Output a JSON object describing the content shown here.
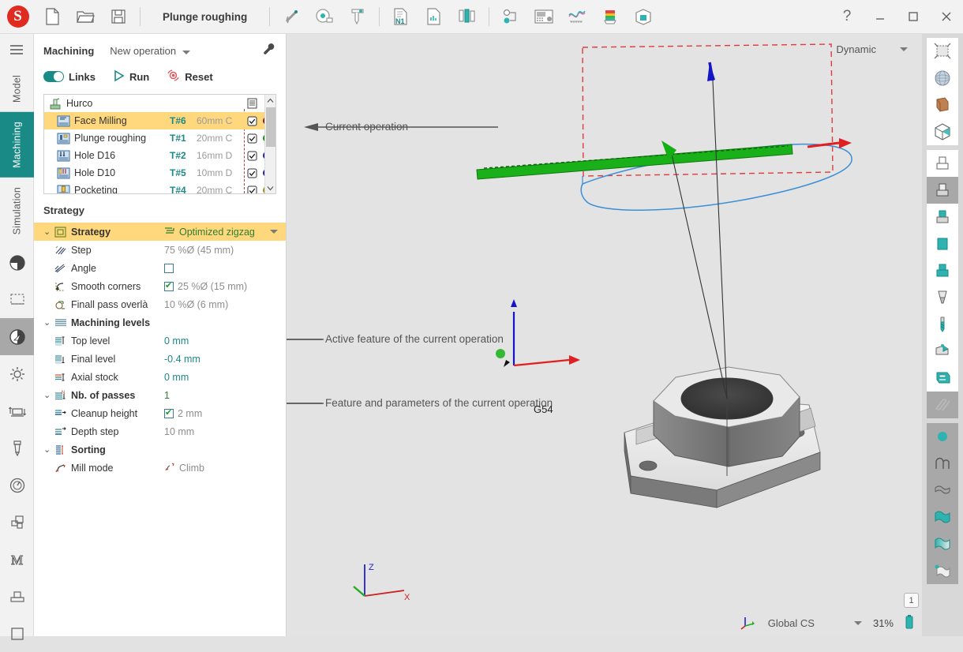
{
  "app": {
    "logo_letter": "S",
    "document_title": "Plunge roughing",
    "help_label": "?",
    "minimize_label": "–",
    "maximize_label": "□",
    "close_label": "✕"
  },
  "top_toolbar": {
    "file_icons": [
      "new-document-icon",
      "open-folder-icon",
      "save-disk-icon"
    ],
    "tool_icons": [
      "magnet-icon",
      "measure-tape-icon",
      "caliper-icon",
      "nc-program-icon",
      "report-document-icon",
      "tool-library-icon",
      "node-link-icon",
      "cnc-controller-icon",
      "feed-curve-icon",
      "stock-colors-icon",
      "stock-box-icon"
    ]
  },
  "left_rail": {
    "menu_icon": "hamburger-icon",
    "tabs": [
      {
        "label": "Model",
        "active": false
      },
      {
        "label": "Machining",
        "active": true
      },
      {
        "label": "Simulation",
        "active": false
      }
    ],
    "icons": [
      {
        "name": "material-sphere-icon",
        "selected": false
      },
      {
        "name": "stock-selection-icon",
        "selected": false
      },
      {
        "name": "compass-navigation-icon",
        "selected": true
      },
      {
        "name": "settings-gear-icon",
        "selected": false
      },
      {
        "name": "machining-levels-icon",
        "selected": false
      },
      {
        "name": "tool-endmill-icon",
        "selected": false
      },
      {
        "name": "speed-gauge-icon",
        "selected": false
      },
      {
        "name": "layers-icon",
        "selected": false
      },
      {
        "name": "macro-m-icon",
        "selected": false
      },
      {
        "name": "fixture-icon",
        "selected": false
      },
      {
        "name": "blank-square-icon",
        "selected": false
      }
    ]
  },
  "panel": {
    "title": "Machining",
    "new_operation_label": "New operation",
    "wrench_icon": "wrench-icon",
    "actions": [
      {
        "name": "links-toggle",
        "label": "Links",
        "icon": "toggle-on-icon"
      },
      {
        "name": "run-button",
        "label": "Run",
        "icon": "play-triangle-icon"
      },
      {
        "name": "reset-button",
        "label": "Reset",
        "icon": "reset-circular-icon"
      }
    ],
    "operations_header": {
      "root_label": "Hurco",
      "root_icon": "machine-post-icon",
      "list_icon": "list-lines-icon"
    },
    "operations": [
      {
        "name": "Face Milling",
        "tool": "T#6",
        "desc": "60mm C",
        "checked": true,
        "dot": "#8b1a1a",
        "icon": "face-milling-icon",
        "selected": true
      },
      {
        "name": "Plunge roughing",
        "tool": "T#1",
        "desc": "20mm C",
        "checked": true,
        "dot": "#128f12",
        "icon": "plunge-roughing-icon",
        "selected": false
      },
      {
        "name": "Hole D16",
        "tool": "T#2",
        "desc": "16mm D",
        "checked": true,
        "dot": "#1a1aa8",
        "icon": "hole-drilling-icon",
        "selected": false
      },
      {
        "name": "Hole D10",
        "tool": "T#5",
        "desc": "10mm D",
        "checked": true,
        "dot": "#1a1aa8",
        "icon": "hole-tapping-icon",
        "selected": false
      },
      {
        "name": "Pocketing",
        "tool": "T#4",
        "desc": "20mm C",
        "checked": true,
        "dot": "#9b8f12",
        "icon": "pocketing-icon",
        "selected": false
      }
    ],
    "strategy_section_title": "Strategy",
    "params": [
      {
        "kind": "group",
        "icon": "strategy-icon",
        "label": "Strategy",
        "value": "Optimized zigzag",
        "value_icon": "zigzag-icon",
        "has_caret": true,
        "highlight": true
      },
      {
        "kind": "row",
        "icon": "step-hatch-icon",
        "label": "Step",
        "value": "75 %Ø (45 mm)"
      },
      {
        "kind": "row",
        "icon": "angle-icon",
        "label": "Angle",
        "value": "",
        "checkbox": "off"
      },
      {
        "kind": "row",
        "icon": "smooth-corners-icon",
        "label": "Smooth corners",
        "value": "25 %Ø (15 mm)",
        "checkbox": "on"
      },
      {
        "kind": "row",
        "icon": "final-pass-overlap-icon",
        "label": "Finall pass overlà",
        "value": "10 %Ø (6 mm)"
      },
      {
        "kind": "group",
        "icon": "machining-levels-icon",
        "label": "Machining levels",
        "value": "",
        "highlight": false
      },
      {
        "kind": "row",
        "icon": "top-level-icon",
        "label": "Top level",
        "value": "0 mm",
        "teal": true
      },
      {
        "kind": "row",
        "icon": "final-level-icon",
        "label": "Final level",
        "value": "-0.4 mm",
        "teal": true
      },
      {
        "kind": "row",
        "icon": "axial-stock-icon",
        "label": "Axial stock",
        "value": "0 mm",
        "teal": true
      },
      {
        "kind": "group",
        "icon": "passes-icon",
        "label": "Nb. of passes",
        "value": "1",
        "teal": true,
        "highlight": false
      },
      {
        "kind": "row",
        "icon": "cleanup-height-icon",
        "label": "Cleanup height",
        "value": "2 mm",
        "checkbox": "on"
      },
      {
        "kind": "row",
        "icon": "depth-step-icon",
        "label": "Depth step",
        "value": "10 mm"
      },
      {
        "kind": "group",
        "icon": "sorting-icon",
        "label": "Sorting",
        "value": "",
        "highlight": false
      },
      {
        "kind": "row",
        "icon": "mill-mode-icon",
        "label": "Mill mode",
        "value": "Climb",
        "value_icon": "climb-icon"
      }
    ]
  },
  "viewport": {
    "view_mode": "Dynamic",
    "annotations": [
      {
        "name": "annotation-current-operation",
        "text": "Current operation"
      },
      {
        "name": "annotation-active-feature",
        "text": "Active feature of the current operation"
      },
      {
        "name": "annotation-feature-parameters",
        "text": "Feature and parameters of the current operation"
      }
    ],
    "model_label": "G54",
    "axis_labels": {
      "z": "Z",
      "x": "X"
    },
    "status": {
      "cs_icon": "coordinate-system-icon",
      "cs_label": "Global CS",
      "zoom": "31%",
      "battery_icon": "battery-icon",
      "layer_badge": "1"
    }
  },
  "right_rail": {
    "groups": [
      {
        "items": [
          {
            "name": "select-region-icon",
            "selected": false
          },
          {
            "name": "globe-sphere-icon",
            "selected": false
          },
          {
            "name": "surface-patch-icon",
            "selected": false
          },
          {
            "name": "wireframe-box-icon",
            "selected": false
          }
        ]
      },
      {
        "items": [
          {
            "name": "stock-cylinder-white-icon",
            "selected": false
          },
          {
            "name": "stock-cylinder-grey-icon",
            "selected": true
          },
          {
            "name": "stock-cylinder-teal-top-icon",
            "selected": false
          },
          {
            "name": "stock-cylinder-teal-icon",
            "selected": false
          },
          {
            "name": "stock-cylinder-teal-band-icon",
            "selected": false
          },
          {
            "name": "stock-cone-icon",
            "selected": false
          },
          {
            "name": "drill-bit-icon",
            "selected": false
          },
          {
            "name": "fixture-clamp-icon",
            "selected": false
          },
          {
            "name": "machine-table-icon",
            "selected": false
          },
          {
            "name": "toolpath-hatch-icon",
            "selected": true
          }
        ]
      },
      {
        "items": [
          {
            "name": "point-dot-icon",
            "selected": true
          },
          {
            "name": "curve-arc-icon",
            "selected": true
          },
          {
            "name": "surface-wave-icon",
            "selected": true
          },
          {
            "name": "surface-teal-icon",
            "selected": true
          },
          {
            "name": "surface-gradient-icon",
            "selected": false
          },
          {
            "name": "surface-point-icon",
            "selected": false
          }
        ]
      }
    ]
  },
  "colors": {
    "accent_teal": "#1a8a87",
    "highlight_amber": "#ffd87e",
    "logo_red": "#e02b20",
    "stock_outline_red": "#e03b3b",
    "feature_blue": "#3a8fd8",
    "toolpath_green": "#19b019"
  }
}
